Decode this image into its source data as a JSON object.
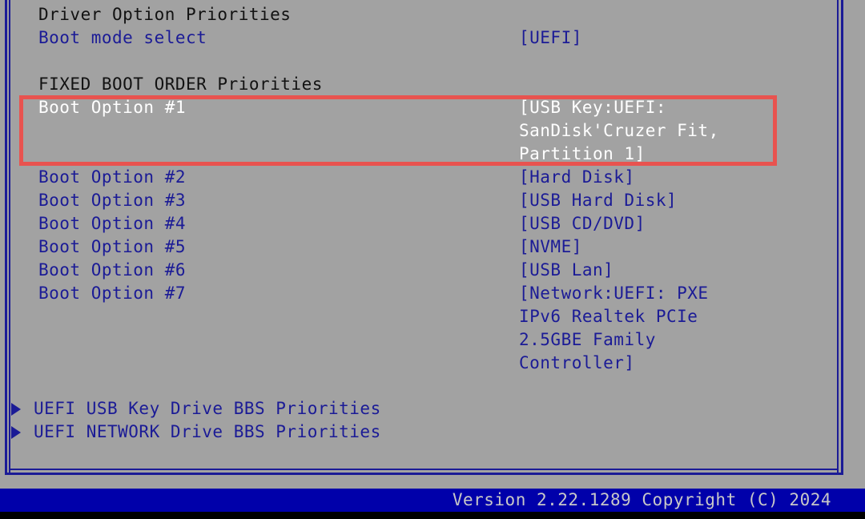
{
  "screen": {
    "background_color": "#a2a2a2",
    "frame_color": "#1b1b96",
    "heading_color": "#121212",
    "item_color": "#1b1b96",
    "selected_color": "#ffffff",
    "highlight_box_color": "#e8534f",
    "footer_bar_color": "#0000aa",
    "footer_text_color": "#c8c8c8"
  },
  "sections": {
    "driver_option_priorities_heading": "Driver Option Priorities",
    "fixed_boot_order_heading": "FIXED BOOT ORDER Priorities"
  },
  "settings": {
    "boot_mode_select": {
      "label": "Boot mode select",
      "value": "[UEFI]"
    }
  },
  "boot_options": [
    {
      "label": "Boot Option #1",
      "value_lines": [
        "[USB Key:UEFI:",
        "SanDisk'Cruzer Fit,",
        "Partition 1]"
      ],
      "selected": true
    },
    {
      "label": "Boot Option #2",
      "value_lines": [
        "[Hard Disk]"
      ],
      "selected": false
    },
    {
      "label": "Boot Option #3",
      "value_lines": [
        "[USB Hard Disk]"
      ],
      "selected": false
    },
    {
      "label": "Boot Option #4",
      "value_lines": [
        "[USB CD/DVD]"
      ],
      "selected": false
    },
    {
      "label": "Boot Option #5",
      "value_lines": [
        "[NVME]"
      ],
      "selected": false
    },
    {
      "label": "Boot Option #6",
      "value_lines": [
        "[USB Lan]"
      ],
      "selected": false
    },
    {
      "label": "Boot Option #7",
      "value_lines": [
        "[Network:UEFI: PXE",
        "IPv6 Realtek PCIe",
        "2.5GBE Family",
        "Controller]"
      ],
      "selected": false
    }
  ],
  "submenus": [
    {
      "icon": "triangle-right-icon",
      "label": "UEFI USB Key Drive BBS Priorities"
    },
    {
      "icon": "triangle-right-icon",
      "label": "UEFI NETWORK Drive BBS Priorities"
    }
  ],
  "footer": {
    "version_text": "Version 2.22.1289 Copyright (C) 2024"
  }
}
